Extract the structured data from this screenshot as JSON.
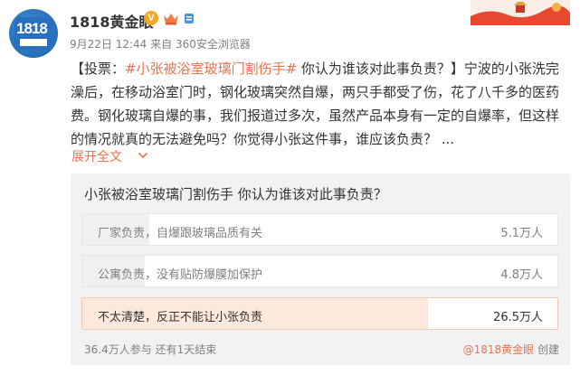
{
  "user": {
    "name": "1818黄金眼",
    "avatar_text": "1818",
    "verified_badge": "V",
    "icons": [
      "verified-icon",
      "crown-icon",
      "fan-icon"
    ]
  },
  "meta": {
    "time": "9月22日 12:44",
    "source": "来自 360安全浏览器"
  },
  "post": {
    "prefix": "【投票：",
    "topic": "#小张被浴室玻璃门割伤手#",
    "body": " 你认为谁该对此事负责？】宁波的小张洗完澡后，在移动浴室门时，钢化玻璃突然自爆，两只手都受了伤，花了八千多的医药费。钢化玻璃自爆的事，我们报道过多次，虽然产品本身有一定的自爆率，但这样的情况就真的无法避免吗？你觉得小张这件事，谁应该负责？ ...",
    "expand_label": "展开全文"
  },
  "poll": {
    "question": "小张被浴室玻璃门割伤手 你认为谁该对此事负责？",
    "options": [
      {
        "label": "厂家负责，自爆跟玻璃品质有关",
        "count": "5.1万人",
        "value_wan": 5.1,
        "selected": false
      },
      {
        "label": "公寓负责，没有贴防爆膜加保护",
        "count": "4.8万人",
        "value_wan": 4.8,
        "selected": false
      },
      {
        "label": "不太清楚，反正不能让小张负责",
        "count": "26.5万人",
        "value_wan": 26.5,
        "selected": true
      }
    ],
    "participants": "36.4万人参与",
    "remaining": "还有1天结束",
    "creator_mention": "@1818黄金眼",
    "creator_suffix": "创建"
  },
  "colors": {
    "accent": "#eb7350",
    "selected_fill": "#fde8dc",
    "badge": "#f6a623"
  }
}
